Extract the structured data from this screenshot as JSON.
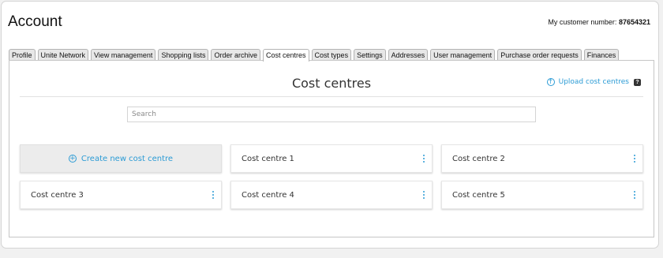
{
  "header": {
    "title": "Account",
    "customer_label": "My customer number:",
    "customer_number": "87654321"
  },
  "tabs": [
    {
      "label": "Profile",
      "name": "tab-profile"
    },
    {
      "label": "Unite Network",
      "name": "tab-unite-network"
    },
    {
      "label": "View management",
      "name": "tab-view-management"
    },
    {
      "label": "Shopping lists",
      "name": "tab-shopping-lists"
    },
    {
      "label": "Order archive",
      "name": "tab-order-archive"
    },
    {
      "label": "Cost centres",
      "name": "tab-cost-centres",
      "active": true
    },
    {
      "label": "Cost types",
      "name": "tab-cost-types"
    },
    {
      "label": "Settings",
      "name": "tab-settings"
    },
    {
      "label": "Addresses",
      "name": "tab-addresses"
    },
    {
      "label": "User management",
      "name": "tab-user-management"
    },
    {
      "label": "Purchase order requests",
      "name": "tab-purchase-order-requests"
    },
    {
      "label": "Finances",
      "name": "tab-finances"
    }
  ],
  "panel": {
    "title": "Cost centres",
    "upload_label": "Upload cost centres",
    "help_label": "?",
    "search_placeholder": "Search",
    "create_label": "Create new cost centre",
    "cost_centres": [
      "Cost centre 1",
      "Cost centre 2",
      "Cost centre 3",
      "Cost centre 4",
      "Cost centre 5"
    ]
  },
  "colors": {
    "accent": "#2b9bd5",
    "text": "#333333",
    "tab_bg": "#e7e7e7"
  },
  "icons": {
    "upload": "upload-circle-icon",
    "create": "plus-circle-icon",
    "menu": "vertical-dots-icon",
    "help": "question-mark-icon"
  }
}
